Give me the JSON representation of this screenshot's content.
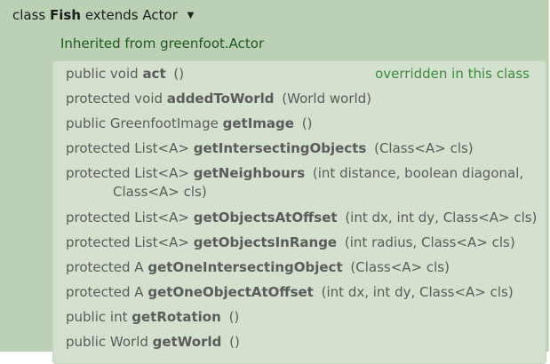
{
  "class_header": {
    "prefix": "class",
    "name": "Fish",
    "extends_label": "extends",
    "superclass": "Actor",
    "caret": "▼"
  },
  "inherited_label": "Inherited from greenfoot.Actor",
  "methods": [
    {
      "modifiers": "public void",
      "name": "act",
      "params": "()",
      "note": "overridden in this class"
    },
    {
      "modifiers": "protected void",
      "name": "addedToWorld",
      "params": "(World world)"
    },
    {
      "modifiers": "public GreenfootImage",
      "name": "getImage",
      "params": "()"
    },
    {
      "modifiers": "protected List<A>",
      "name": "getIntersectingObjects",
      "params": "(Class<A> cls)"
    },
    {
      "modifiers": "protected List<A>",
      "name": "getNeighbours",
      "params": "(int distance, boolean diagonal,",
      "params_cont": "Class<A> cls)"
    },
    {
      "modifiers": "protected List<A>",
      "name": "getObjectsAtOffset",
      "params": "(int dx, int dy, Class<A> cls)"
    },
    {
      "modifiers": "protected List<A>",
      "name": "getObjectsInRange",
      "params": "(int radius, Class<A> cls)"
    },
    {
      "modifiers": "protected A",
      "name": "getOneIntersectingObject",
      "params": "(Class<A> cls)"
    },
    {
      "modifiers": "protected A",
      "name": "getOneObjectAtOffset",
      "params": "(int dx, int dy, Class<A> cls)"
    },
    {
      "modifiers": "public int",
      "name": "getRotation",
      "params": "()"
    },
    {
      "modifiers": "public World",
      "name": "getWorld",
      "params": "()"
    }
  ]
}
